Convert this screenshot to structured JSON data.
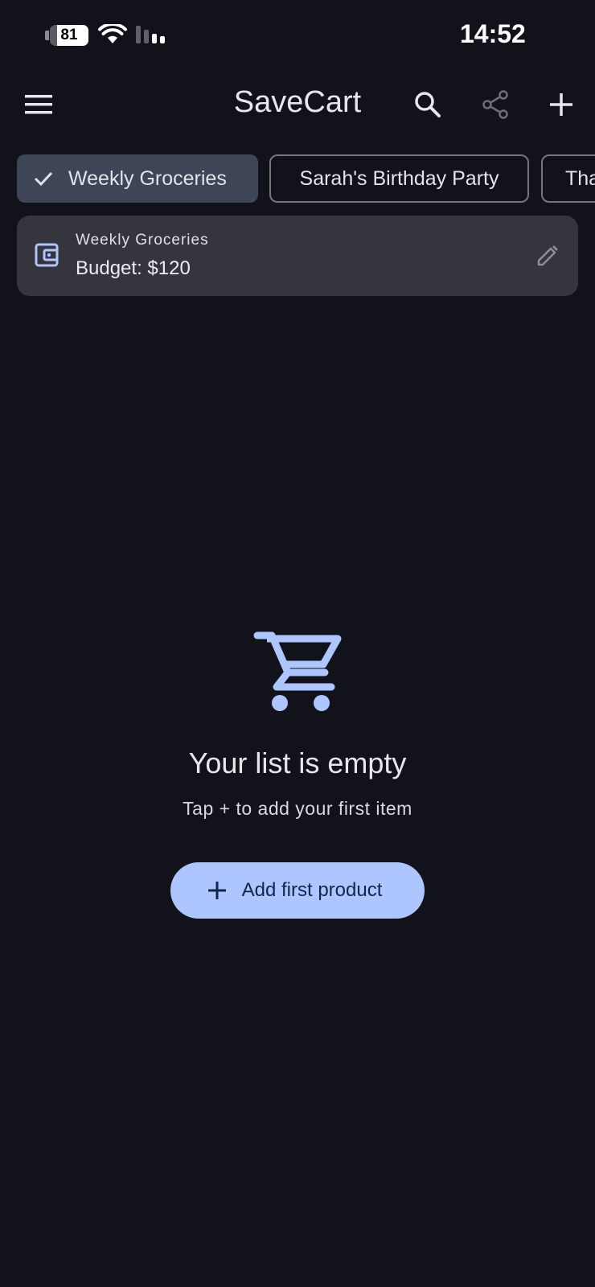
{
  "status_bar": {
    "battery_percent": "81",
    "battery_level": 0.81,
    "time": "14:52"
  },
  "app_bar": {
    "title": "SaveCart",
    "icons": [
      "menu-icon",
      "search-icon",
      "share-icon",
      "add-icon"
    ]
  },
  "lists": {
    "chips": [
      {
        "label": "Weekly Groceries",
        "selected": true
      },
      {
        "label": "Sarah's Birthday Party",
        "selected": false
      },
      {
        "label": "Tha",
        "selected": false
      }
    ]
  },
  "budget_card": {
    "list_name": "Weekly Groceries",
    "budget_text": "Budget: $120"
  },
  "empty_state": {
    "title": "Your list is empty",
    "subtitle": "Tap + to add your first item",
    "button_label": "Add first product"
  },
  "colors": {
    "background": "#12131a",
    "accent": "#aec6ff",
    "chip_selected": "#3d4556",
    "card": "#35363d"
  }
}
